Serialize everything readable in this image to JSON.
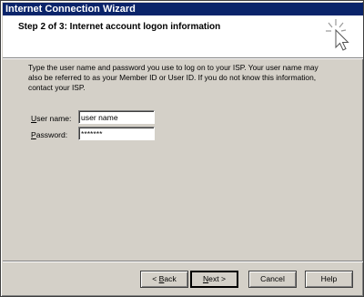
{
  "window": {
    "title": "Internet Connection Wizard"
  },
  "header": {
    "title": "Step 2 of 3: Internet account logon information"
  },
  "content": {
    "description": "Type the user name and password you use to log on to your ISP. Your user name may also be referred to as your Member ID or User ID. If you do not know this information, contact your ISP."
  },
  "form": {
    "username_label_prefix": "U",
    "username_label_rest": "ser name:",
    "username_value": "user name",
    "password_label_prefix": "P",
    "password_label_rest": "assword:",
    "password_value": "*******"
  },
  "buttons": {
    "back_prefix": "< ",
    "back_accel": "B",
    "back_rest": "ack",
    "next_accel": "N",
    "next_rest": "ext >",
    "cancel": "Cancel",
    "help": "Help"
  },
  "icons": {
    "header_icon": "cursor-sparkle-icon"
  }
}
